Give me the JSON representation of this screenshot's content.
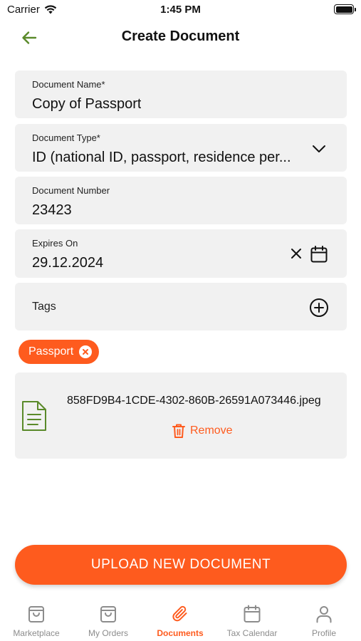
{
  "status_bar": {
    "carrier": "Carrier",
    "time": "1:45 PM"
  },
  "nav": {
    "title": "Create Document"
  },
  "form": {
    "document_name": {
      "label": "Document Name*",
      "value": "Copy of Passport"
    },
    "document_type": {
      "label": "Document Type*",
      "value": "ID (national ID, passport, residence per..."
    },
    "document_number": {
      "label": "Document Number",
      "value": "23423"
    },
    "expires_on": {
      "label": "Expires On",
      "value": "29.12.2024"
    },
    "tags": {
      "label": "Tags"
    }
  },
  "tags_selected": [
    {
      "label": "Passport"
    }
  ],
  "attachment": {
    "file_name": "858FD9B4-1CDE-4302-860B-26591A073446.jpeg",
    "remove_label": "Remove"
  },
  "upload_button": {
    "label": "UPLOAD NEW DOCUMENT"
  },
  "tabbar": {
    "items": [
      {
        "label": "Marketplace",
        "icon": "shopping-bag-icon"
      },
      {
        "label": "My Orders",
        "icon": "shopping-bag-icon"
      },
      {
        "label": "Documents",
        "icon": "paperclip-icon",
        "active": true
      },
      {
        "label": "Tax Calendar",
        "icon": "calendar-icon"
      },
      {
        "label": "Profile",
        "icon": "person-icon"
      }
    ]
  },
  "colors": {
    "accent": "#fe5b1e",
    "back_arrow": "#5a8a2a",
    "field_bg": "#f1f1f1",
    "tab_inactive": "#8c8c8c"
  }
}
